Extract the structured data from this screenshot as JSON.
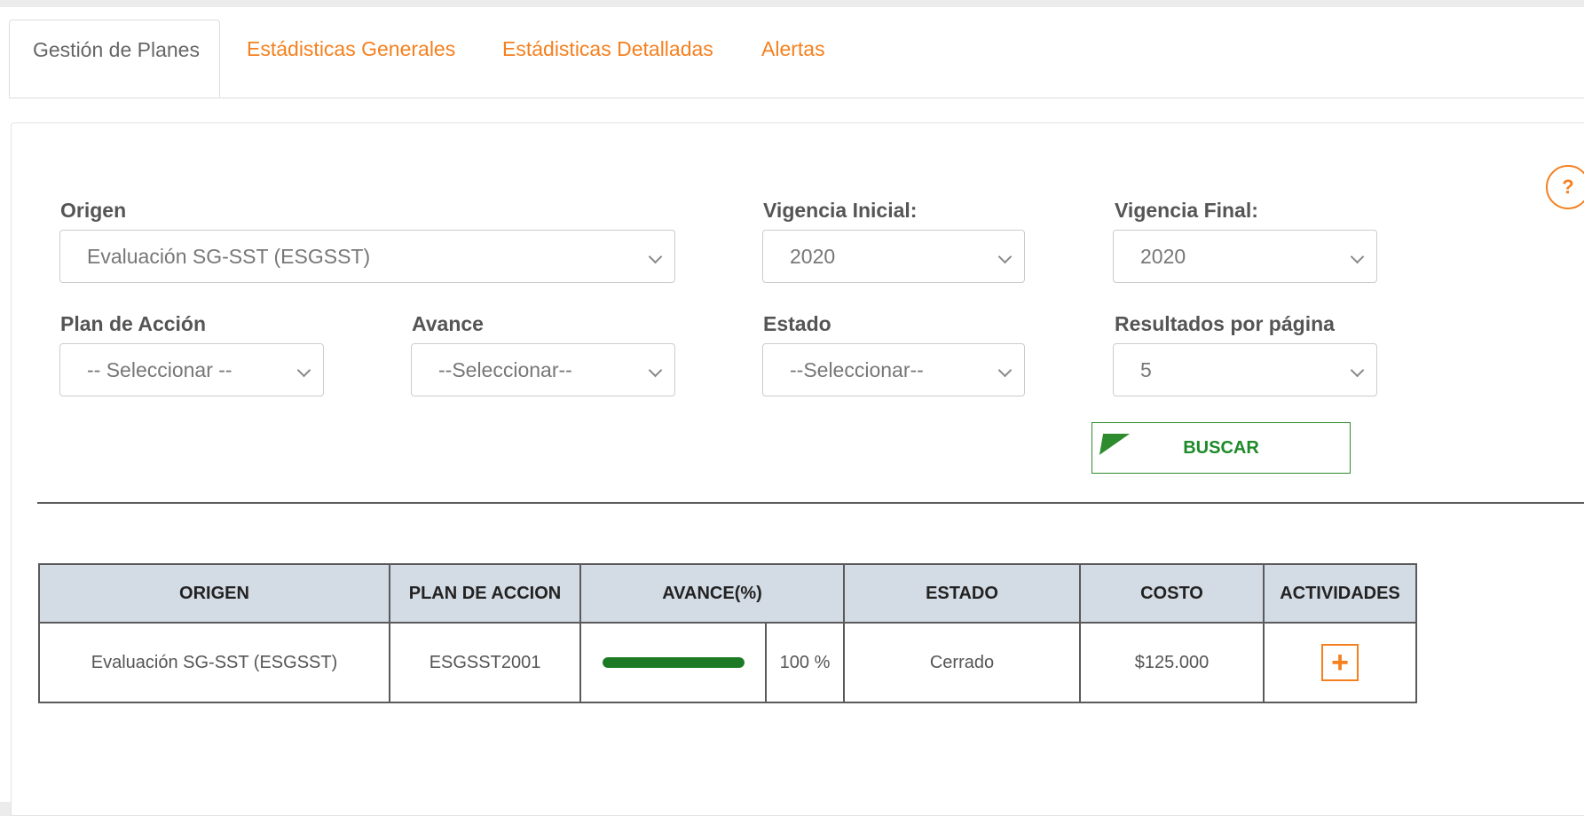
{
  "tabs": [
    {
      "label": "Gestión de Planes",
      "active": true
    },
    {
      "label": "Estádisticas Generales",
      "active": false
    },
    {
      "label": "Estádisticas Detalladas",
      "active": false
    },
    {
      "label": "Alertas",
      "active": false
    }
  ],
  "filters": {
    "origen": {
      "label": "Origen",
      "value": "Evaluación SG-SST (ESGSST)"
    },
    "vigencia_inicial": {
      "label": "Vigencia Inicial:",
      "value": "2020"
    },
    "vigencia_final": {
      "label": "Vigencia Final:",
      "value": "2020"
    },
    "plan_accion": {
      "label": "Plan de Acción",
      "value": "-- Seleccionar --"
    },
    "avance": {
      "label": "Avance",
      "value": "--Seleccionar--"
    },
    "estado": {
      "label": "Estado",
      "value": "--Seleccionar--"
    },
    "resultados": {
      "label": "Resultados por página",
      "value": "5"
    }
  },
  "buscar_label": "BUSCAR",
  "help_icon": "question-circle-icon",
  "table": {
    "headers": [
      "ORIGEN",
      "PLAN DE ACCION",
      "AVANCE(%)",
      "ESTADO",
      "COSTO",
      "ACTIVIDADES"
    ],
    "rows": [
      {
        "origen": "Evaluación SG-SST (ESGSST)",
        "plan": "ESGSST2001",
        "avance_fraction": 1.0,
        "avance_text": "100 %",
        "estado": "Cerrado",
        "costo": "$125.000",
        "add_icon": "plus-icon"
      }
    ]
  },
  "colors": {
    "accent": "#f5801f",
    "success": "#1c7a25",
    "header_bg": "#d3dbe4"
  }
}
